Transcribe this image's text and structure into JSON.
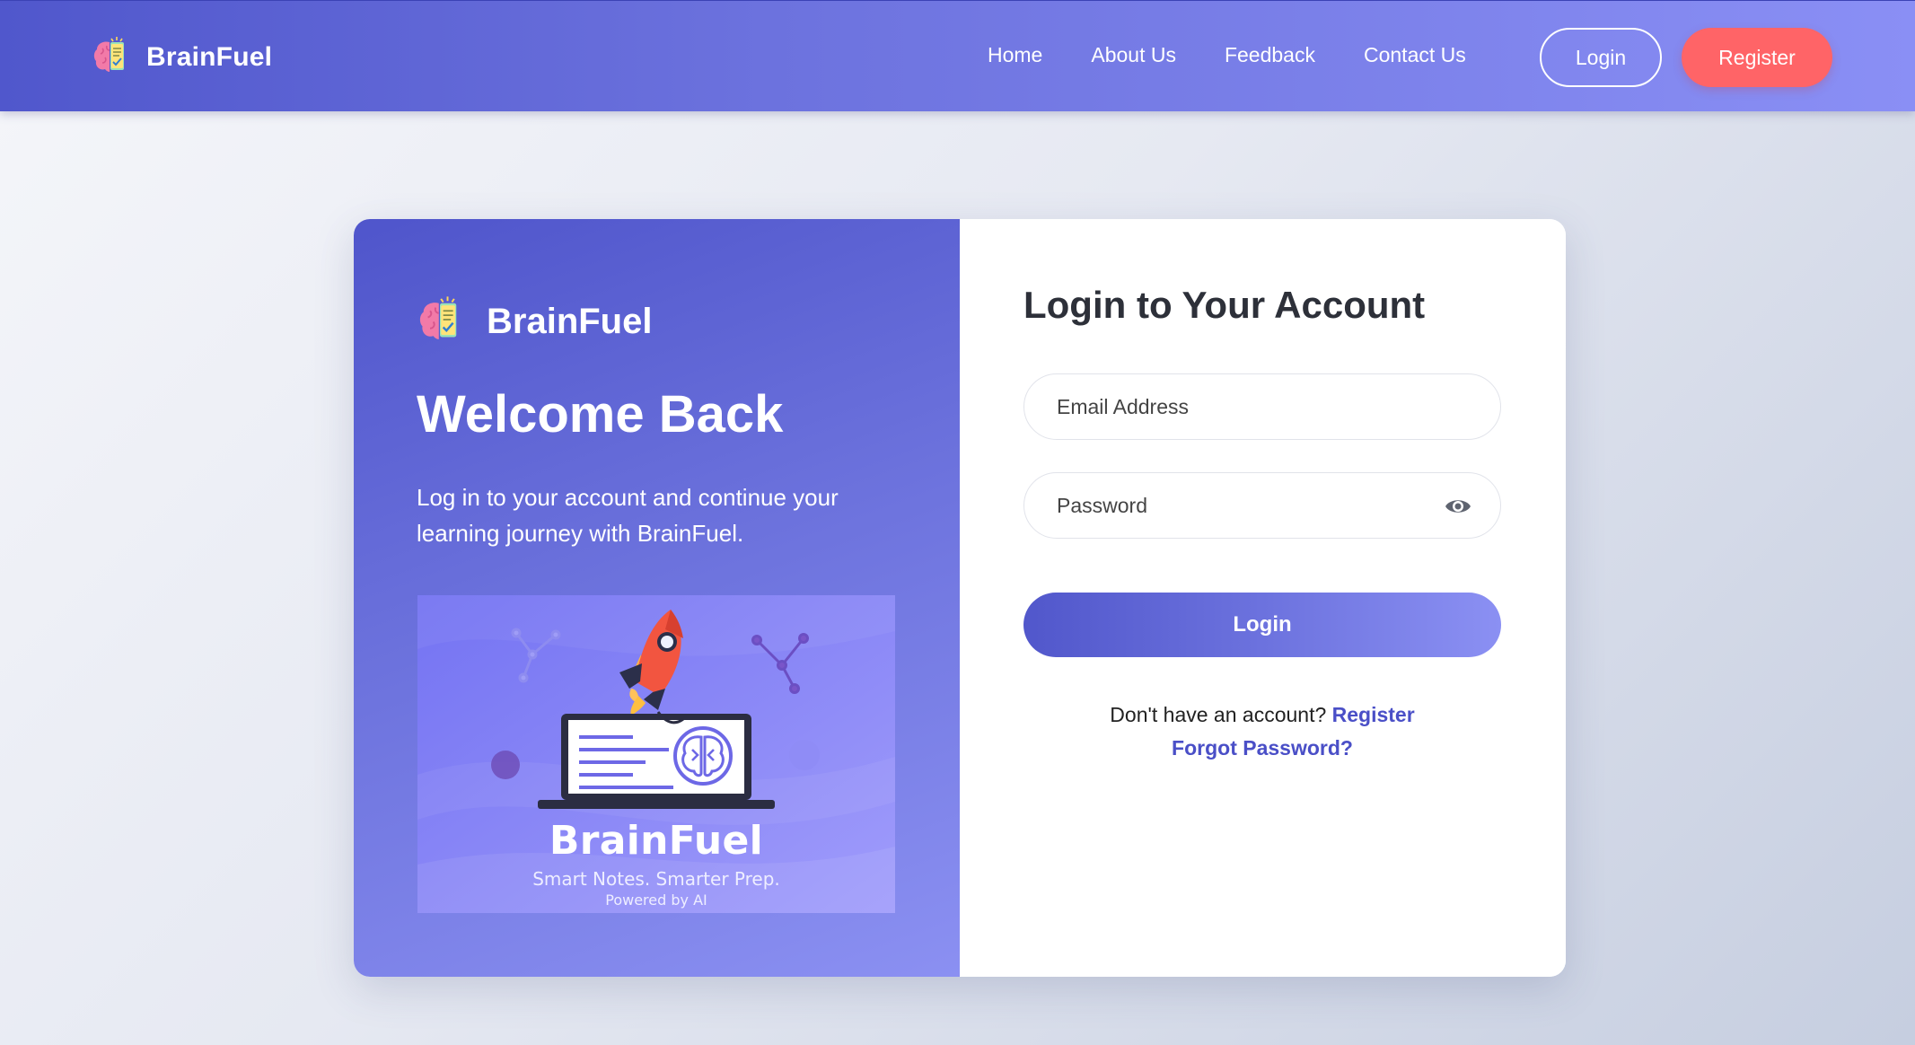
{
  "navbar": {
    "brand_name": "BrainFuel",
    "brand_icon": "brain-notes-icon",
    "links": [
      "Home",
      "About Us",
      "Feedback",
      "Contact Us"
    ],
    "login_label": "Login",
    "register_label": "Register"
  },
  "left_panel": {
    "brand_name": "BrainFuel",
    "brand_icon": "brain-notes-icon",
    "title": "Welcome Back",
    "description": "Log in to your account and continue your learning journey with BrainFuel.",
    "illustration": {
      "title": "BrainFuel",
      "tagline": "Smart Notes. Smarter Prep.",
      "powered_by": "Powered by AI",
      "icons": [
        "rocket-icon",
        "laptop-icon",
        "brain-icon",
        "network-node-icon"
      ]
    }
  },
  "login_form": {
    "title": "Login to Your Account",
    "email_placeholder": "Email Address",
    "password_placeholder": "Password",
    "password_toggle_icon": "eye-icon",
    "submit_label": "Login",
    "no_account_text": "Don't have an account?",
    "register_link": "Register",
    "forgot_link": "Forgot Password?"
  },
  "colors": {
    "primary": "#5157cb",
    "primary_light": "#8b90f3",
    "register_button": "#ff6467",
    "link": "#4a4fc7",
    "title_text": "#2d3039"
  }
}
